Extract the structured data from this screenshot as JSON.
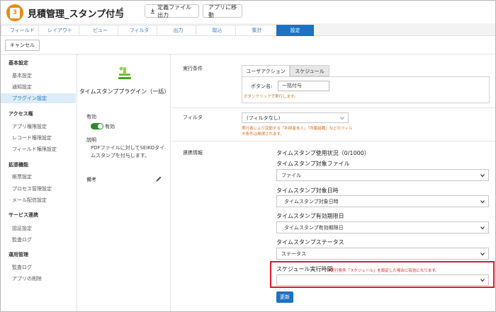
{
  "app": {
    "icon_text": "3",
    "title": "見積管理_スタンプ付与"
  },
  "header": {
    "export_label": "定義ファイル出力",
    "goto_app_label": "アプリに移動"
  },
  "tabs": [
    "フィールド",
    "レイアウト",
    "ビュー",
    "フィルタ",
    "出力",
    "取込",
    "集計",
    "設定"
  ],
  "active_tab": "設定",
  "cancel_label": "キャンセル",
  "sidebar": {
    "sections": [
      {
        "title": "基本設定",
        "items": [
          "基本設定",
          "通知設定",
          "プラグイン設定"
        ]
      },
      {
        "title": "アクセス権",
        "items": [
          "アプリ権限設定",
          "レコード権限設定",
          "フィールド権限設定"
        ]
      },
      {
        "title": "拡張機能",
        "items": [
          "帳票設定",
          "プロセス管理設定",
          "メール配信設定"
        ]
      },
      {
        "title": "サービス連携",
        "items": [
          "認証設定",
          "監査ログ"
        ]
      },
      {
        "title": "運用管理",
        "items": [
          "監査ログ",
          "アプリの削除"
        ]
      }
    ],
    "active_item": "プラグイン設定"
  },
  "plugin": {
    "name": "タイムスタンププラグイン（一括）",
    "enabled_title": "有効",
    "enabled_value": "有効",
    "desc_title": "説明",
    "description": "PDFファイルに対してSEIKOタイムスタンプを付与します。",
    "notes_title": "備考"
  },
  "exec": {
    "label": "実行条件",
    "tabs": [
      "ユーザアクション",
      "スケジュール"
    ],
    "button_name_label": "ボタン名:",
    "button_name_value": "一括付与",
    "hint": "ボタンクリックで実行します。"
  },
  "filter": {
    "label": "フィルタ",
    "value": "(フィルタなし)",
    "note1": "実行者により変動する「利用者本人」「所属組織」などのフィル",
    "note2": "タ条件は無視されます。"
  },
  "link": {
    "label": "連携情報",
    "usage": "タイムスタンプ使用状況（0/1000）",
    "fields": [
      {
        "title": "タイムスタンプ対象ファイル",
        "value": "ファイル"
      },
      {
        "title": "タイムスタンプ対象日時",
        "value": "タイムスタンプ対象日時"
      },
      {
        "title": "タイムスタンプ有効期限日",
        "value": "タイムスタンプ有効期限日"
      },
      {
        "title": "タイムスタンプステータス",
        "value": "ステータス"
      }
    ],
    "schedule_title": "スケジュール実行時間",
    "schedule_note": "※実行条件「スケジュール」を設定した場合に有効になります。",
    "schedule_value": ""
  },
  "update_label": "更新",
  "colors": {
    "accent": "#1e72c4",
    "highlight": "#e31b1b",
    "toggle_on": "#2c8a2c",
    "app_icon": "#e88b1a"
  }
}
